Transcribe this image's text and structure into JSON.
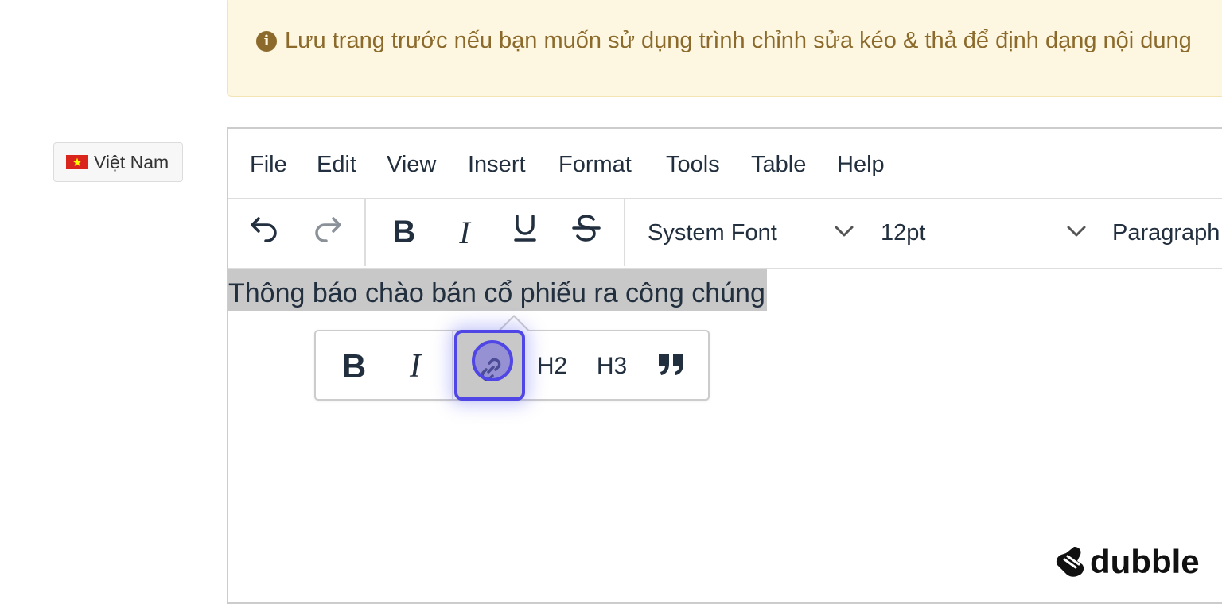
{
  "notice": {
    "icon": "info-circle-icon",
    "text": "Lưu trang trước nếu bạn muốn sử dụng trình chỉnh sửa kéo & thả để định dạng nội dung"
  },
  "language": {
    "flag_icon": "vietnam-flag-icon",
    "label": "Việt Nam"
  },
  "menubar": {
    "items": [
      "File",
      "Edit",
      "View",
      "Insert",
      "Format",
      "Tools",
      "Table",
      "Help"
    ]
  },
  "toolbar": {
    "font_family": "System Font",
    "font_size": "12pt",
    "block_format": "Paragraph"
  },
  "content": {
    "text": "Thông báo chào bán cổ phiếu ra công chúng"
  },
  "quickbar": {
    "bold": "B",
    "italic": "I",
    "h2": "H2",
    "h3": "H3"
  },
  "watermark": {
    "text": "dubble"
  },
  "colors": {
    "notice_bg": "#fdf6e0",
    "notice_text": "#8b6a2b",
    "highlight": "#4f46e5",
    "selection": "#c8c8c8"
  }
}
